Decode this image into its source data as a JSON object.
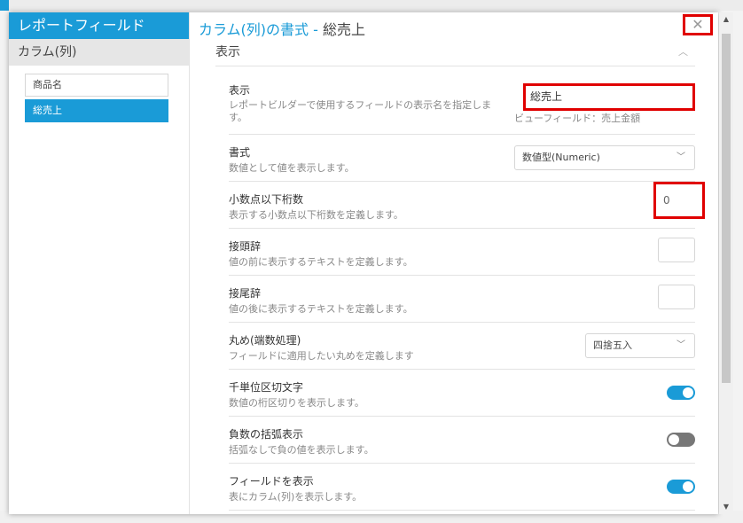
{
  "left_panel": {
    "title": "レポートフィールド",
    "subtitle": "カラム(列)",
    "fields": [
      "商品名",
      "総売上"
    ]
  },
  "right_panel": {
    "title_prefix": "カラム(列)の書式 - ",
    "title_name": "総売上",
    "close": "✕",
    "section": "表示",
    "rows": {
      "display": {
        "title": "表示",
        "desc": "レポートビルダーで使用するフィールドの表示名を指定します。",
        "value": "総売上",
        "hint": "ビューフィールド：売上金額"
      },
      "format": {
        "title": "書式",
        "desc": "数値として値を表示します。",
        "value": "数値型(Numeric)"
      },
      "decimals": {
        "title": "小数点以下桁数",
        "desc": "表示する小数点以下桁数を定義します。",
        "value": "0"
      },
      "prefix": {
        "title": "接頭辞",
        "desc": "値の前に表示するテキストを定義します。",
        "value": ""
      },
      "suffix": {
        "title": "接尾辞",
        "desc": "値の後に表示するテキストを定義します。",
        "value": ""
      },
      "rounding": {
        "title": "丸め(端数処理)",
        "desc": "フィールドに適用したい丸めを定義します",
        "value": "四捨五入"
      },
      "thousands": {
        "title": "千単位区切文字",
        "desc": "数値の桁区切りを表示します。",
        "on": true
      },
      "negative": {
        "title": "負数の括弧表示",
        "desc": "括弧なしで負の値を表示します。",
        "on": false
      },
      "show_field": {
        "title": "フィールドを表示",
        "desc": "表にカラム(列)を表示します。",
        "on": true
      }
    }
  },
  "colors": {
    "accent": "#1a9bd7",
    "highlight": "#e00000"
  }
}
